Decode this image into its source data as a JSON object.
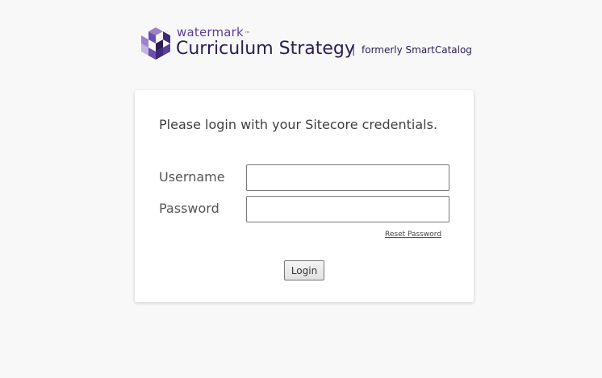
{
  "brand": {
    "company": "watermark",
    "trademark": "™",
    "product": "Curriculum Strategy",
    "separator": "|",
    "formerly": "formerly SmartCatalog",
    "logo_icon": "watermark-cube-logo",
    "colors": {
      "primary": "#5a3f99",
      "dark": "#2b1d52",
      "light": "#9b84c9"
    }
  },
  "login": {
    "heading": "Please login with your Sitecore credentials.",
    "username_label": "Username",
    "username_value": "",
    "password_label": "Password",
    "password_value": "",
    "reset_label": "Reset Password",
    "submit_label": "Login"
  }
}
